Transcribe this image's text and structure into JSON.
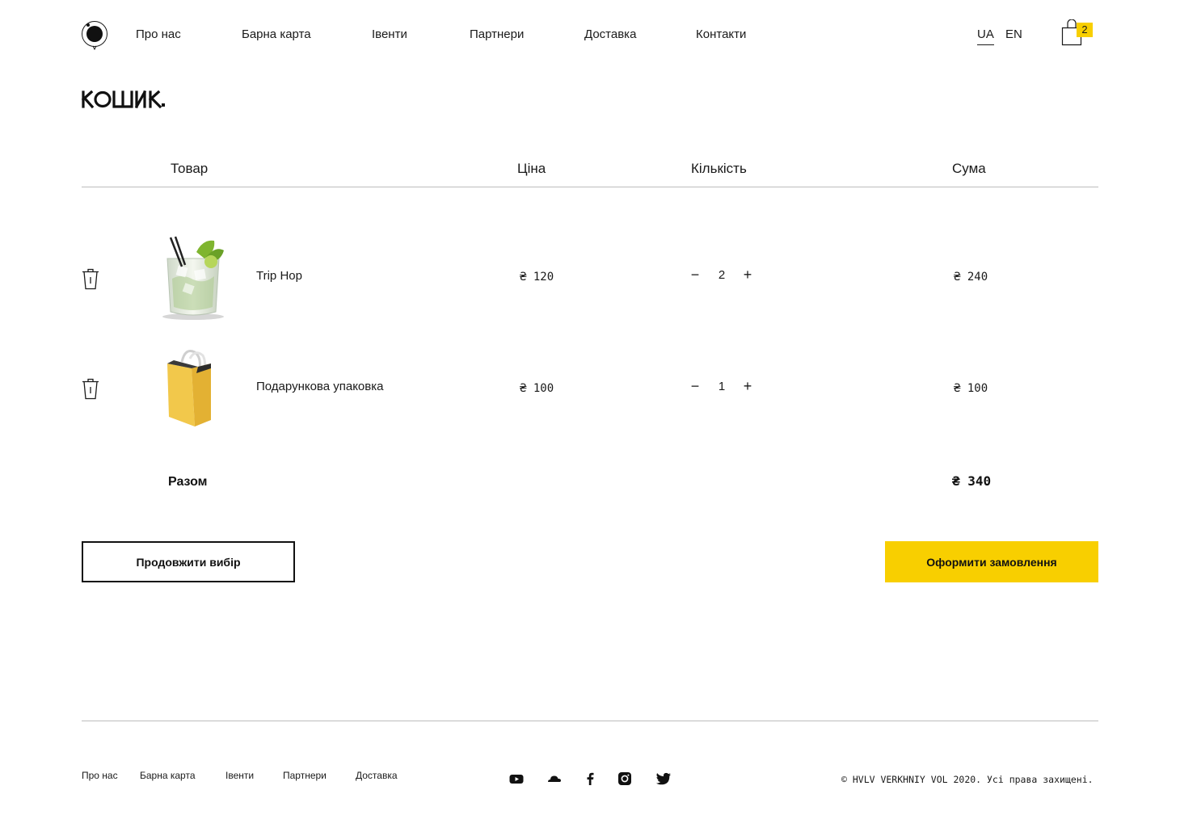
{
  "header": {
    "nav": [
      {
        "label": "Про нас"
      },
      {
        "label": "Барна карта"
      },
      {
        "label": "Івенти"
      },
      {
        "label": "Партнери"
      },
      {
        "label": "Доставка"
      },
      {
        "label": "Контакти"
      }
    ],
    "languages": [
      {
        "code": "UA",
        "active": true
      },
      {
        "code": "EN",
        "active": false
      }
    ],
    "cart": {
      "count": "2",
      "icon": "shopping-bag-icon"
    }
  },
  "page": {
    "title": "КОШИК"
  },
  "table": {
    "columns": [
      "Товар",
      "Ціна",
      "Кількість",
      "Сума"
    ],
    "rows": [
      {
        "name": "Trip Hop",
        "price": "₴ 120",
        "quantity": "2",
        "sum": "₴ 240",
        "image": "cocktail-glass-image"
      },
      {
        "name": "Подарункова упаковка",
        "price": "₴ 100",
        "quantity": "1",
        "sum": "₴ 100",
        "image": "gift-bag-image"
      }
    ],
    "qty_minus": "−",
    "qty_plus": "+"
  },
  "total": {
    "label": "Разом",
    "value": "₴ 340"
  },
  "actions": {
    "continue_label": "Продовжити вибір",
    "checkout_label": "Оформити замовлення"
  },
  "footer": {
    "nav": [
      {
        "label": "Про нас"
      },
      {
        "label": "Барна карта"
      },
      {
        "label": "Івенти"
      },
      {
        "label": "Партнери"
      },
      {
        "label": "Доставка"
      }
    ],
    "social": [
      "youtube-icon",
      "soundcloud-icon",
      "facebook-icon",
      "instagram-icon",
      "twitter-icon"
    ],
    "copyright": "© HVLV VERKHNIY VOL 2020. Усі права захищені."
  },
  "colors": {
    "accent": "#f8cf00",
    "text": "#1a1a1a",
    "divider": "#bdbdbd",
    "background": "#ffffff"
  }
}
